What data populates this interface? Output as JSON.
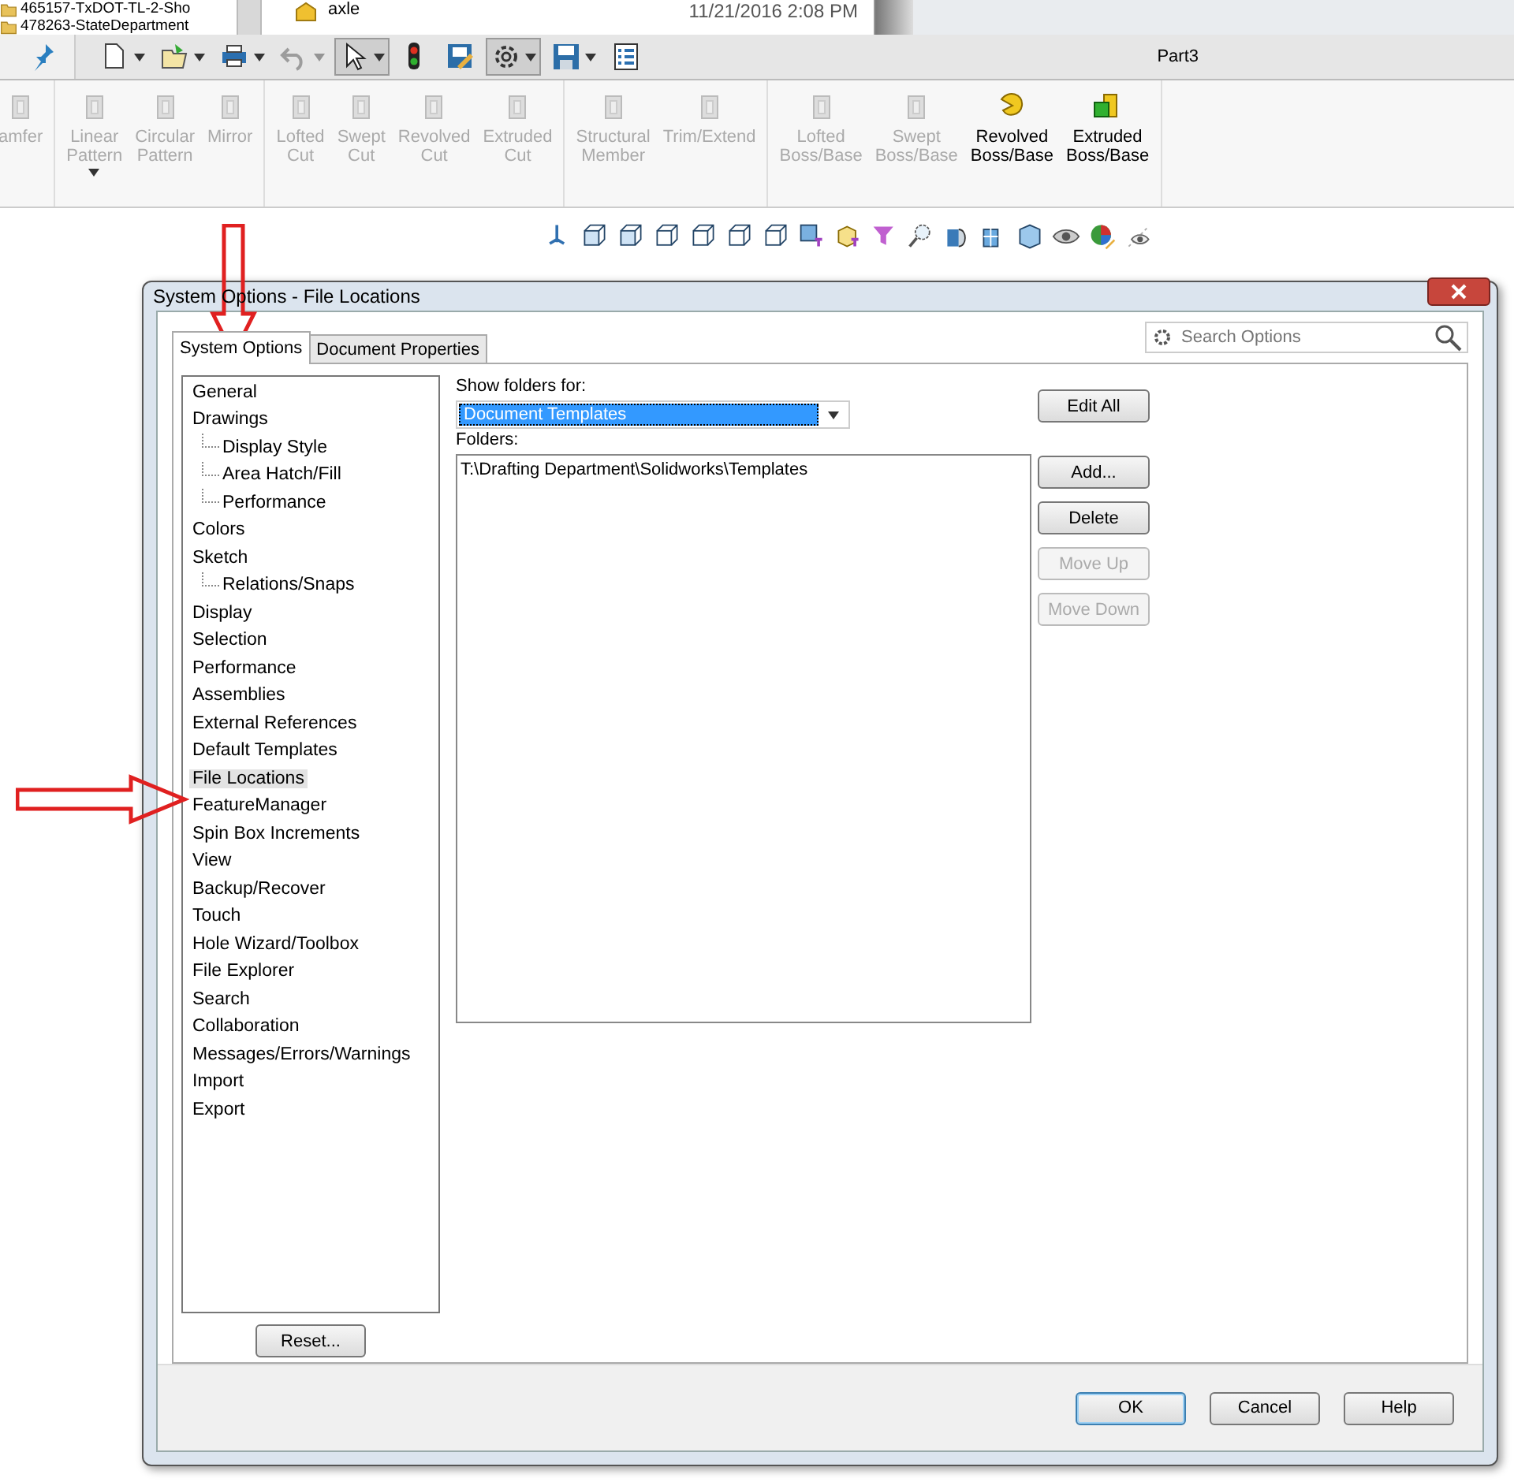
{
  "file_browser": {
    "folders": [
      {
        "label": "465157-TxDOT-TL-2-Sho"
      },
      {
        "label": "478263-StateDepartment"
      }
    ],
    "file": {
      "name": "axle",
      "modified": "11/21/2016 2:08 PM"
    }
  },
  "quick_access_toolbar": {
    "tools": [
      {
        "kind": "pin",
        "dropdown": false,
        "selected": false,
        "disabled": false
      },
      {
        "kind": "new",
        "dropdown": true,
        "selected": false,
        "disabled": false
      },
      {
        "kind": "open",
        "dropdown": true,
        "selected": false,
        "disabled": false
      },
      {
        "kind": "print",
        "dropdown": true,
        "selected": false,
        "disabled": false
      },
      {
        "kind": "undo",
        "dropdown": true,
        "selected": false,
        "disabled": true
      },
      {
        "kind": "select",
        "dropdown": true,
        "selected": true,
        "disabled": false
      },
      {
        "kind": "rebuild",
        "dropdown": false,
        "selected": false,
        "disabled": false
      },
      {
        "kind": "file-properties",
        "dropdown": false,
        "selected": false,
        "disabled": false
      },
      {
        "kind": "options",
        "dropdown": true,
        "selected": true,
        "disabled": false
      },
      {
        "kind": "save",
        "dropdown": true,
        "selected": false,
        "disabled": false
      },
      {
        "kind": "list",
        "dropdown": false,
        "selected": false,
        "disabled": false
      }
    ],
    "document_title": "Part3"
  },
  "command_ribbon": {
    "groups": [
      [
        {
          "label": "amfer",
          "disabled": true,
          "dropdown": false
        }
      ],
      [
        {
          "label": "Linear Pattern",
          "disabled": true,
          "dropdown": true
        },
        {
          "label": "Circular Pattern",
          "disabled": true,
          "dropdown": false
        },
        {
          "label": "Mirror",
          "disabled": true,
          "dropdown": false
        }
      ],
      [
        {
          "label": "Lofted Cut",
          "disabled": true,
          "dropdown": false
        },
        {
          "label": "Swept Cut",
          "disabled": true,
          "dropdown": false
        },
        {
          "label": "Revolved Cut",
          "disabled": true,
          "dropdown": false
        },
        {
          "label": "Extruded Cut",
          "disabled": true,
          "dropdown": false
        }
      ],
      [
        {
          "label": "Structural Member",
          "disabled": true,
          "dropdown": false
        },
        {
          "label": "Trim/Extend",
          "disabled": true,
          "dropdown": false
        }
      ],
      [
        {
          "label": "Lofted Boss/Base",
          "disabled": true,
          "dropdown": false
        },
        {
          "label": "Swept Boss/Base",
          "disabled": true,
          "dropdown": false
        },
        {
          "label": "Revolved Boss/Base",
          "disabled": false,
          "dropdown": false
        },
        {
          "label": "Extruded Boss/Base",
          "disabled": false,
          "dropdown": false
        }
      ]
    ]
  },
  "dialog": {
    "title": "System Options - File Locations",
    "tabs": [
      {
        "label": "System Options",
        "selected": true
      },
      {
        "label": "Document Properties",
        "selected": false
      }
    ],
    "search": {
      "placeholder": "Search Options"
    },
    "tree": [
      {
        "label": "General",
        "selected": false
      },
      {
        "label": "Drawings",
        "selected": false,
        "children": [
          {
            "label": "Display Style",
            "selected": false
          },
          {
            "label": "Area Hatch/Fill",
            "selected": false
          },
          {
            "label": "Performance",
            "selected": false
          }
        ]
      },
      {
        "label": "Colors",
        "selected": false
      },
      {
        "label": "Sketch",
        "selected": false,
        "children": [
          {
            "label": "Relations/Snaps",
            "selected": false
          }
        ]
      },
      {
        "label": "Display",
        "selected": false
      },
      {
        "label": "Selection",
        "selected": false
      },
      {
        "label": "Performance",
        "selected": false
      },
      {
        "label": "Assemblies",
        "selected": false
      },
      {
        "label": "External References",
        "selected": false
      },
      {
        "label": "Default Templates",
        "selected": false
      },
      {
        "label": "File Locations",
        "selected": true
      },
      {
        "label": "FeatureManager",
        "selected": false
      },
      {
        "label": "Spin Box Increments",
        "selected": false
      },
      {
        "label": "View",
        "selected": false
      },
      {
        "label": "Backup/Recover",
        "selected": false
      },
      {
        "label": "Touch",
        "selected": false
      },
      {
        "label": "Hole Wizard/Toolbox",
        "selected": false
      },
      {
        "label": "File Explorer",
        "selected": false
      },
      {
        "label": "Search",
        "selected": false
      },
      {
        "label": "Collaboration",
        "selected": false
      },
      {
        "label": "Messages/Errors/Warnings",
        "selected": false
      },
      {
        "label": "Import",
        "selected": false
      },
      {
        "label": "Export",
        "selected": false
      }
    ],
    "reset_button": "Reset...",
    "show_folders_for": {
      "label": "Show folders for:",
      "value": "Document Templates"
    },
    "folders": {
      "label": "Folders:",
      "items": [
        {
          "label": "T:\\Drafting Department\\Solidworks\\Templates",
          "selected": false
        }
      ]
    },
    "side_buttons": [
      {
        "label": "Edit All",
        "disabled": false
      },
      {
        "label": "Add...",
        "disabled": false
      },
      {
        "label": "Delete",
        "disabled": false
      },
      {
        "label": "Move Up",
        "disabled": true
      },
      {
        "label": "Move Down",
        "disabled": true
      }
    ],
    "footer_buttons": [
      {
        "label": "OK",
        "default": true
      },
      {
        "label": "Cancel",
        "default": false
      },
      {
        "label": "Help",
        "default": false
      }
    ]
  }
}
